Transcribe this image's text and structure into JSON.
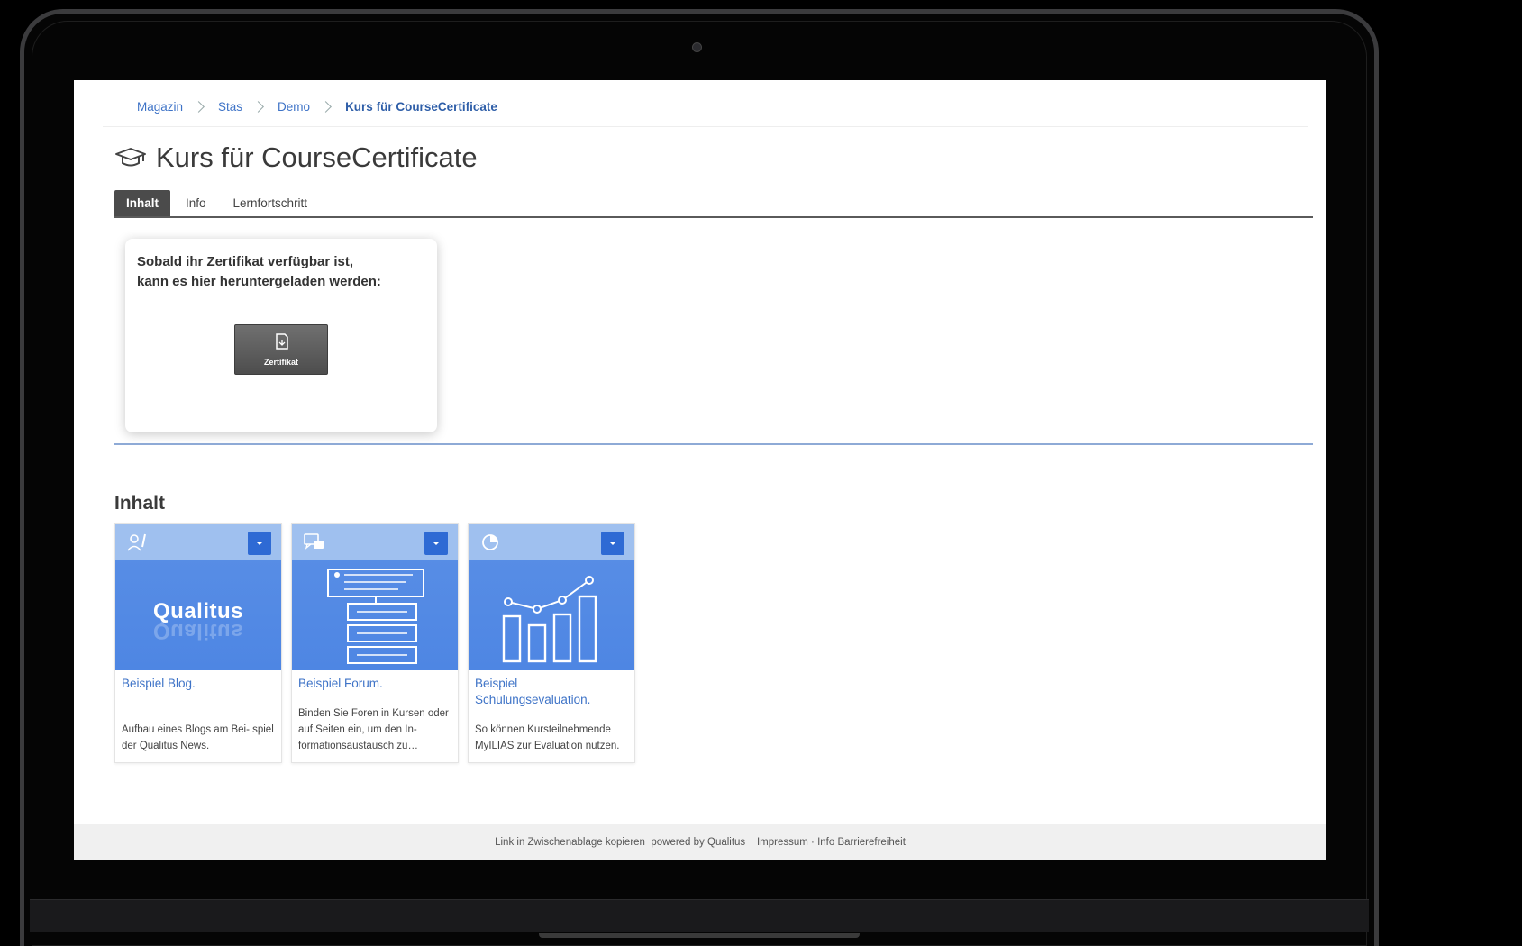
{
  "breadcrumb": {
    "items": [
      "Magazin",
      "Stas",
      "Demo"
    ],
    "current": "Kurs für CourseCertificate"
  },
  "page": {
    "title": "Kurs für CourseCertificate"
  },
  "tabs": [
    {
      "label": "Inhalt",
      "active": true
    },
    {
      "label": "Info",
      "active": false
    },
    {
      "label": "Lernfortschritt",
      "active": false
    }
  ],
  "certificate": {
    "text_line1": "Sobald ihr Zertifikat verfügbar ist,",
    "text_line2": "kann es hier heruntergeladen werden:",
    "button_label": "Zertifikat"
  },
  "content": {
    "heading": "Inhalt",
    "tiles": [
      {
        "type_icon": "blog-icon",
        "title": "Beispiel Blog.",
        "image_text": "Qualitus",
        "description": "Aufbau eines Blogs am Bei- spiel der Qualitus News."
      },
      {
        "type_icon": "forum-icon",
        "title": "Beispiel Forum.",
        "description": "Binden Sie Foren in Kursen oder auf Seiten ein, um den In- formationsaustausch zu…"
      },
      {
        "type_icon": "survey-icon",
        "title": "Beispiel Schulungsevaluation.",
        "description": "So können Kursteilnehmende MyILIAS zur Evaluation nutzen."
      }
    ]
  },
  "footer": {
    "copy_link": "Link in Zwischenablage kopieren",
    "powered": "powered by Qualitus",
    "impressum": "Impressum",
    "separator": "·",
    "accessibility": "Info Barrierefreiheit"
  },
  "colors": {
    "link": "#3e73c7",
    "tile_blue": "#4e86e3",
    "tile_header": "#9fc0ef",
    "menu_button": "#2e6ad4",
    "active_tab": "#4b4b4b"
  }
}
